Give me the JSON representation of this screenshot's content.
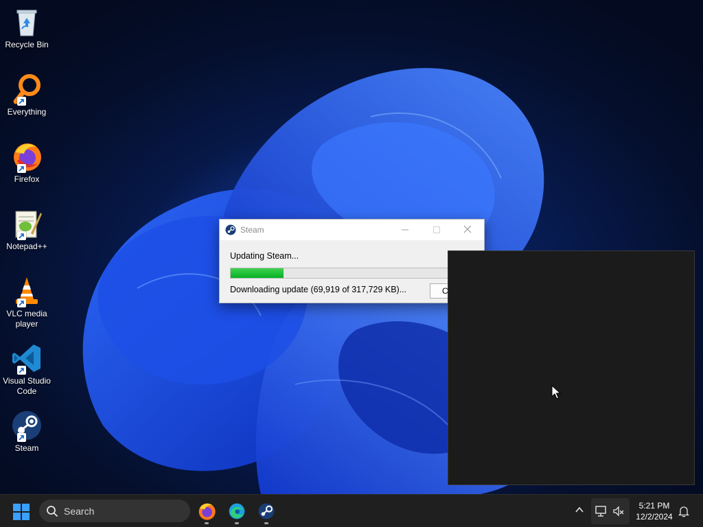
{
  "desktop_icons": [
    {
      "id": "recycle-bin",
      "label": "Recycle Bin",
      "icon": "recycle-bin-icon"
    },
    {
      "id": "everything",
      "label": "Everything",
      "icon": "magnifier-icon"
    },
    {
      "id": "firefox",
      "label": "Firefox",
      "icon": "firefox-icon"
    },
    {
      "id": "notepadpp",
      "label": "Notepad++",
      "icon": "notepadpp-icon"
    },
    {
      "id": "vlc",
      "label": "VLC media player",
      "icon": "vlc-cone-icon"
    },
    {
      "id": "vscode",
      "label": "Visual Studio Code",
      "icon": "vscode-icon"
    },
    {
      "id": "steam",
      "label": "Steam",
      "icon": "steam-icon"
    }
  ],
  "steam_dialog": {
    "title": "Steam",
    "status": "Updating Steam...",
    "progress_downloaded_kb": 69919,
    "progress_total_kb": 317729,
    "download_text": "Downloading update (69,919 of 317,729 KB)...",
    "cancel_label": "Cancel"
  },
  "taskbar": {
    "search_label": "Search",
    "pinned_apps": [
      "firefox-icon",
      "edge-icon",
      "steam-icon"
    ],
    "clock_time": "5:21 PM",
    "clock_date": "12/2/2024"
  },
  "colors": {
    "progress_green": "#06b025",
    "taskbar_bg": "#1f1f1f",
    "windows_accent": "#0078d4"
  }
}
